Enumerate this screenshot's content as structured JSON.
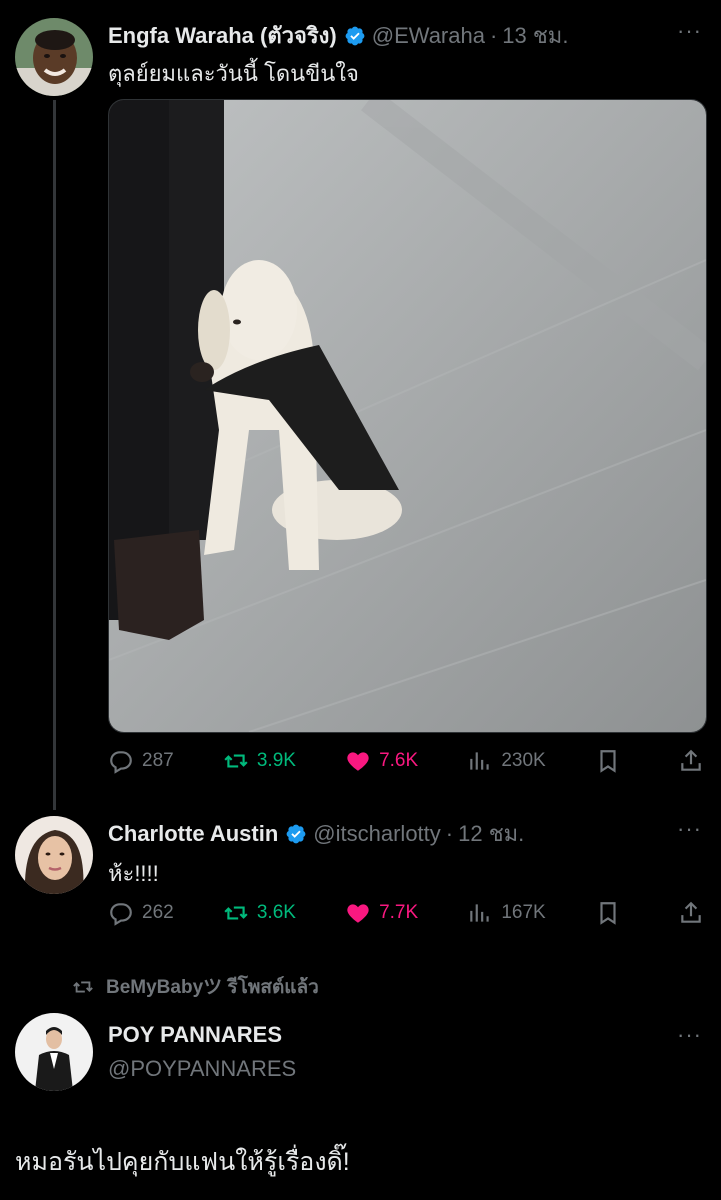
{
  "tweet1": {
    "name": "Engfa Waraha (ตัวจริง)",
    "handle": "@EWaraha",
    "time": "13 ชม.",
    "text": "ตุลย์ยมและวันนี้ โดนขีนใจ",
    "stats": {
      "replies": "287",
      "retweets": "3.9K",
      "likes": "7.6K",
      "views": "230K"
    }
  },
  "tweet2": {
    "name": "Charlotte Austin",
    "handle": "@itscharlotty",
    "time": "12 ชม.",
    "text": "ห้ะ!!!!",
    "stats": {
      "replies": "262",
      "retweets": "3.6K",
      "likes": "7.7K",
      "views": "167K"
    }
  },
  "tweet3": {
    "repost_label": "BeMyBabyツ รีโพสต์แล้ว",
    "name": "POY PANNARES",
    "handle": "@POYPANNARES",
    "text": "หมอรันไปคุยกับแฟนให้รู้เรื่องดิ๊!"
  },
  "ui": {
    "more": "···",
    "separator": "·"
  },
  "colors": {
    "accent": "#1d9bf0",
    "retweet": "#00ba7c",
    "like": "#f91880",
    "muted": "#71767b"
  }
}
